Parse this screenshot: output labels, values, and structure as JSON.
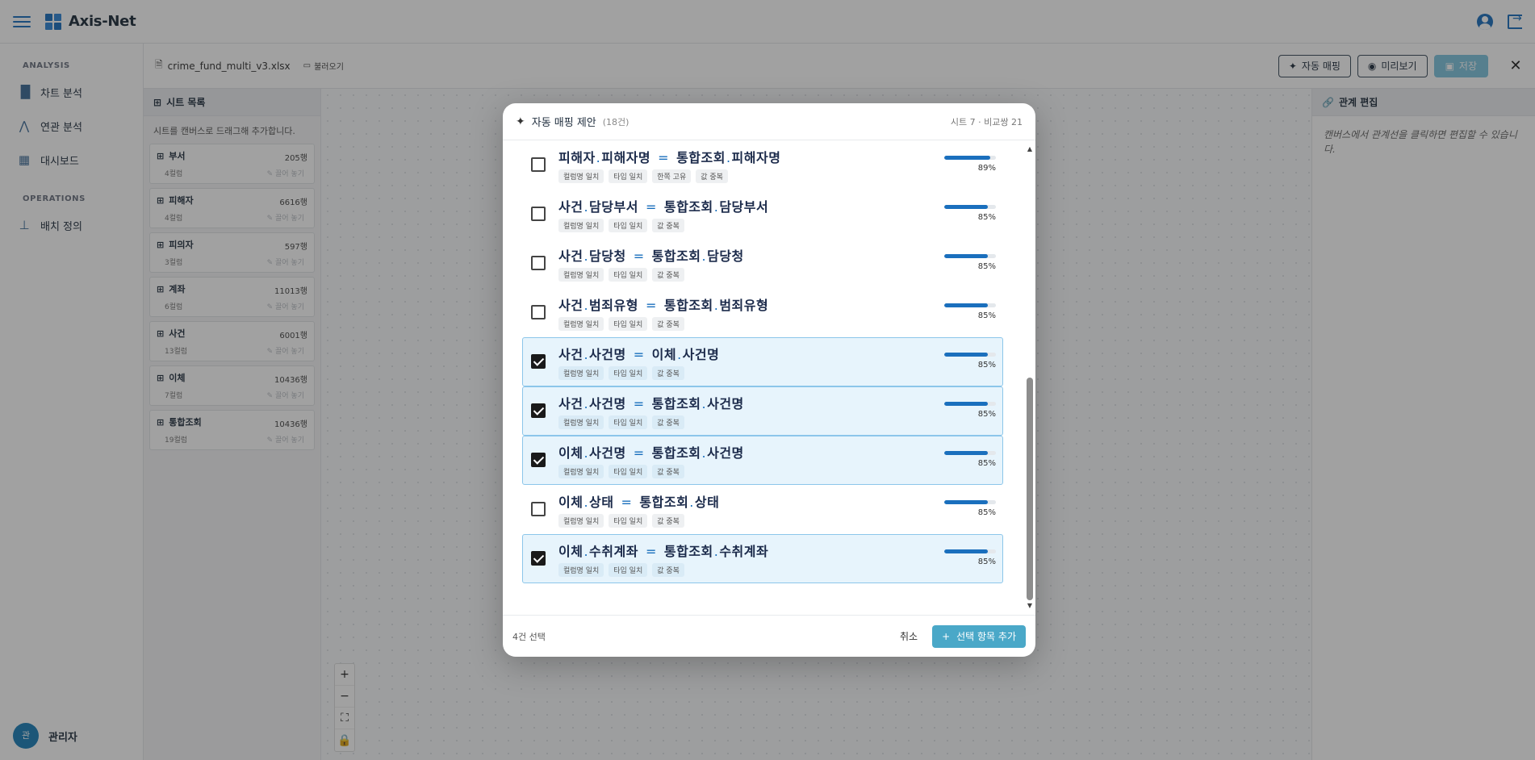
{
  "app": {
    "title": "Axis-Net"
  },
  "nav": {
    "sections": [
      {
        "label": "ANALYSIS",
        "items": [
          {
            "label": "차트 분석",
            "icon": "bar-chart-icon"
          },
          {
            "label": "연관 분석",
            "icon": "network-icon"
          },
          {
            "label": "대시보드",
            "icon": "dashboard-icon"
          }
        ]
      },
      {
        "label": "OPERATIONS",
        "items": [
          {
            "label": "배치 정의",
            "icon": "sitemap-icon"
          }
        ]
      }
    ],
    "user": {
      "initial": "관",
      "name": "관리자"
    }
  },
  "filebar": {
    "file_name": "crime_fund_multi_v3.xlsx",
    "load_label": "불러오기",
    "auto_map_label": "자동 매핑",
    "preview_label": "미리보기",
    "save_label": "저장"
  },
  "sheets": {
    "title": "시트 목록",
    "hint": "시트를 캔버스로 드래그해 추가합니다.",
    "drag_label": "끌어 놓기",
    "items": [
      {
        "name": "부서",
        "rows": "205행",
        "cols": "4컬럼"
      },
      {
        "name": "피해자",
        "rows": "6616행",
        "cols": "4컬럼"
      },
      {
        "name": "피의자",
        "rows": "597행",
        "cols": "3컬럼"
      },
      {
        "name": "계좌",
        "rows": "11013행",
        "cols": "6컬럼"
      },
      {
        "name": "사건",
        "rows": "6001행",
        "cols": "13컬럼"
      },
      {
        "name": "이체",
        "rows": "10436행",
        "cols": "7컬럼"
      },
      {
        "name": "통합조회",
        "rows": "10436행",
        "cols": "19컬럼"
      }
    ]
  },
  "right_panel": {
    "title": "관계 편집",
    "hint": "캔버스에서 관계선을 클릭하면 편집할 수 있습니다."
  },
  "modal": {
    "title": "자동 매핑 제안",
    "count": "(18건)",
    "meta": "시트 7 · 비교쌍 21",
    "selected_count": "4건 선택",
    "cancel_label": "취소",
    "add_label": "선택 항목 추가",
    "rows": [
      {
        "left_sheet": "피해자",
        "left_col": "피해자명",
        "right_sheet": "통합조회",
        "right_col": "피해자명",
        "tags": [
          "컬럼명 일치",
          "타입 일치",
          "한쪽 고유",
          "값 중복"
        ],
        "score": 0.89,
        "pct": "89%",
        "checked": false
      },
      {
        "left_sheet": "사건",
        "left_col": "담당부서",
        "right_sheet": "통합조회",
        "right_col": "담당부서",
        "tags": [
          "컬럼명 일치",
          "타입 일치",
          "값 중복"
        ],
        "score": 0.85,
        "pct": "85%",
        "checked": false
      },
      {
        "left_sheet": "사건",
        "left_col": "담당청",
        "right_sheet": "통합조회",
        "right_col": "담당청",
        "tags": [
          "컬럼명 일치",
          "타입 일치",
          "값 중복"
        ],
        "score": 0.85,
        "pct": "85%",
        "checked": false
      },
      {
        "left_sheet": "사건",
        "left_col": "범죄유형",
        "right_sheet": "통합조회",
        "right_col": "범죄유형",
        "tags": [
          "컬럼명 일치",
          "타입 일치",
          "값 중복"
        ],
        "score": 0.85,
        "pct": "85%",
        "checked": false
      },
      {
        "left_sheet": "사건",
        "left_col": "사건명",
        "right_sheet": "이체",
        "right_col": "사건명",
        "tags": [
          "컬럼명 일치",
          "타입 일치",
          "값 중복"
        ],
        "score": 0.85,
        "pct": "85%",
        "checked": true
      },
      {
        "left_sheet": "사건",
        "left_col": "사건명",
        "right_sheet": "통합조회",
        "right_col": "사건명",
        "tags": [
          "컬럼명 일치",
          "타입 일치",
          "값 중복"
        ],
        "score": 0.85,
        "pct": "85%",
        "checked": true
      },
      {
        "left_sheet": "이체",
        "left_col": "사건명",
        "right_sheet": "통합조회",
        "right_col": "사건명",
        "tags": [
          "컬럼명 일치",
          "타입 일치",
          "값 중복"
        ],
        "score": 0.85,
        "pct": "85%",
        "checked": true
      },
      {
        "left_sheet": "이체",
        "left_col": "상태",
        "right_sheet": "통합조회",
        "right_col": "상태",
        "tags": [
          "컬럼명 일치",
          "타입 일치",
          "값 중복"
        ],
        "score": 0.85,
        "pct": "85%",
        "checked": false
      },
      {
        "left_sheet": "이체",
        "left_col": "수취계좌",
        "right_sheet": "통합조회",
        "right_col": "수취계좌",
        "tags": [
          "컬럼명 일치",
          "타입 일치",
          "값 중복"
        ],
        "score": 0.85,
        "pct": "85%",
        "checked": true
      }
    ]
  },
  "colors": {
    "accent": "#1a6fbd",
    "add_button": "#4aa8c8",
    "checked_row": "#e7f4fc"
  }
}
